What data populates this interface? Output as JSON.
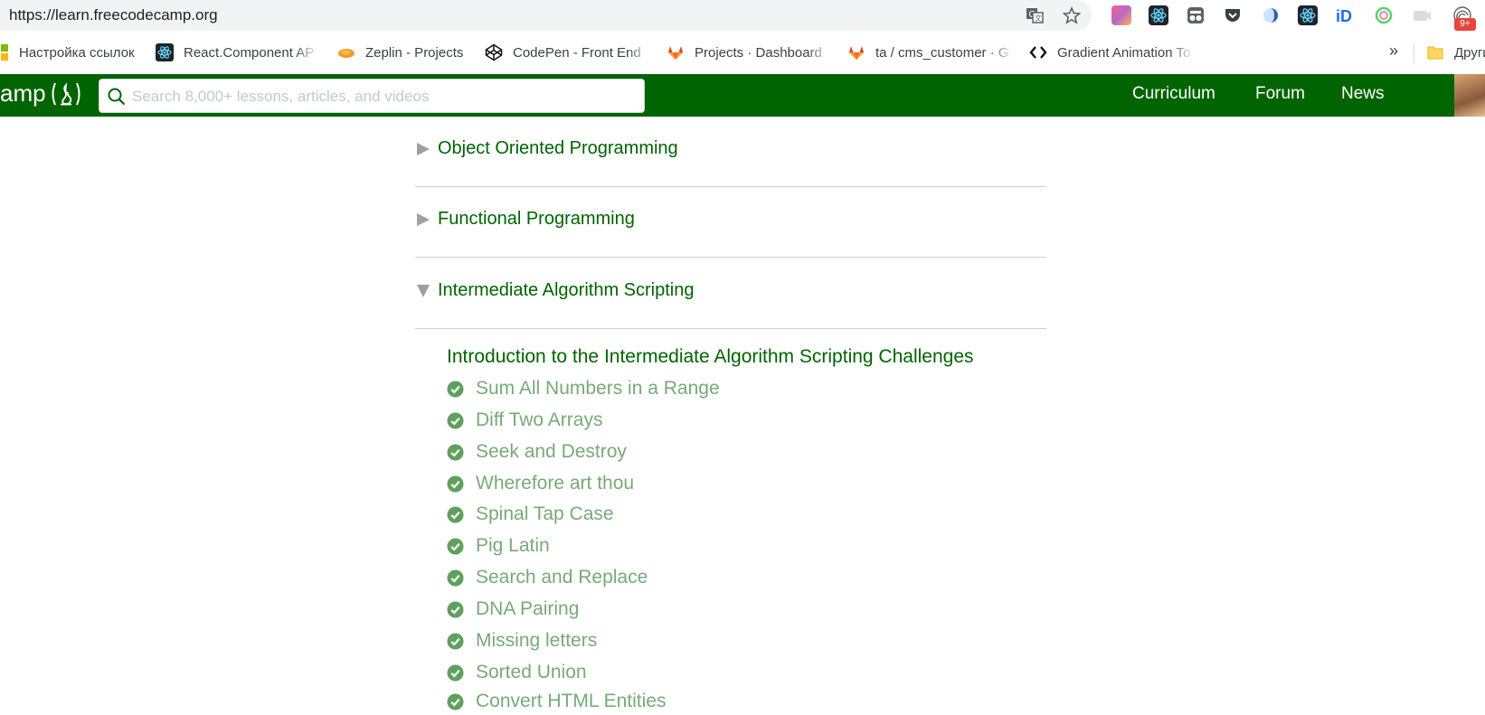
{
  "browser": {
    "url": "https://learn.freecodecamp.org",
    "more_bookmarks": "»",
    "other_bookmarks": "Другие закладки",
    "extension_badge": "9+",
    "bookmarks": [
      {
        "label": "Настройка ссылок",
        "icon": "windows-icon"
      },
      {
        "label": "React.Component API",
        "icon": "react-icon"
      },
      {
        "label": "Zeplin - Projects",
        "icon": "zeplin-icon"
      },
      {
        "label": "CodePen - Front End",
        "icon": "codepen-icon"
      },
      {
        "label": "Projects · Dashboard",
        "icon": "gitlab-icon"
      },
      {
        "label": "ta / cms_customer · GitLab",
        "icon": "gitlab-icon"
      },
      {
        "label": "Gradient Animation Tool",
        "icon": "code-brackets-icon"
      }
    ]
  },
  "nav": {
    "logo_text": "amp",
    "search_placeholder": "Search 8,000+ lessons, articles, and videos",
    "links": [
      "Curriculum",
      "Forum",
      "News"
    ]
  },
  "sections": [
    {
      "title": "Object Oriented Programming",
      "expanded": false
    },
    {
      "title": "Functional Programming",
      "expanded": false
    },
    {
      "title": "Intermediate Algorithm Scripting",
      "expanded": true
    }
  ],
  "intro_title": "Introduction to the Intermediate Algorithm Scripting Challenges",
  "challenges": [
    "Sum All Numbers in a Range",
    "Diff Two Arrays",
    "Seek and Destroy",
    "Wherefore art thou",
    "Spinal Tap Case",
    "Pig Latin",
    "Search and Replace",
    "DNA Pairing",
    "Missing letters",
    "Sorted Union",
    "Convert HTML Entities"
  ],
  "colors": {
    "brand_green": "#006400",
    "completed_green": "#77aa77",
    "check_green": "#5fa05f"
  }
}
